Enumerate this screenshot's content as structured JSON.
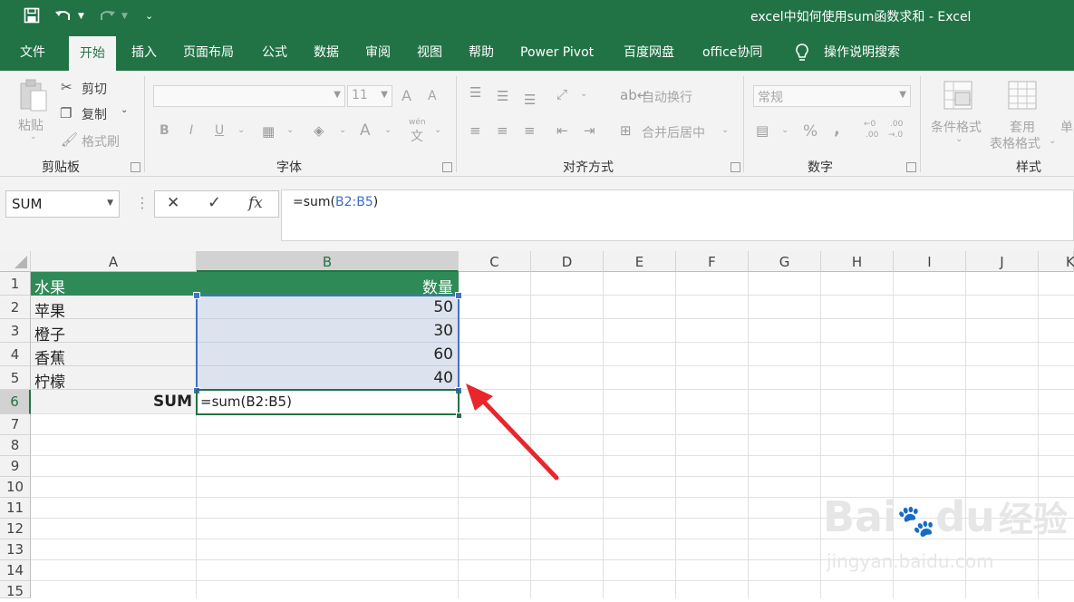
{
  "titlebar": {
    "title": "excel中如何使用sum函数求和  -  Excel",
    "bg_color": "#217346",
    "icons": [
      "save-icon",
      "undo-icon",
      "redo-icon",
      "customize-qat-icon"
    ]
  },
  "tabs": [
    "文件",
    "开始",
    "插入",
    "页面布局",
    "公式",
    "数据",
    "审阅",
    "视图",
    "帮助",
    "Power Pivot",
    "百度网盘",
    "office协同",
    "操作说明搜索"
  ],
  "active_tab": "开始",
  "ribbon": {
    "clipboard": {
      "paste": "粘贴",
      "cut": "剪切",
      "copy": "复制",
      "format_painter": "格式刷",
      "label": "剪贴板"
    },
    "font": {
      "size": "11",
      "bold": "B",
      "italic": "I",
      "underline": "U",
      "font_color": "A",
      "phonetic_top": "wén",
      "phonetic_bottom": "文",
      "grow": "A",
      "shrink": "A",
      "label": "字体"
    },
    "alignment": {
      "wrap_text": "自动换行",
      "merge_center": "合并后居中",
      "label": "对齐方式"
    },
    "number": {
      "format": "常规",
      "percent": "%",
      "comma": ",",
      "inc_decimal_top": "←0",
      "inc_decimal_bottom": ".00",
      "dec_decimal_top": ".00",
      "dec_decimal_bottom": "→.0",
      "label": "数字"
    },
    "styles": {
      "conditional": "条件格式",
      "table_format_1": "套用",
      "table_format_2": "表格格式",
      "cell_styles": "单",
      "label": "样式"
    }
  },
  "formula_bar": {
    "name_box": "SUM",
    "cancel": "✕",
    "enter": "✓",
    "fx": "fx",
    "formula_prefix": "=sum(",
    "formula_ref": "B2:B5",
    "formula_suffix": ")"
  },
  "columns": [
    "A",
    "B",
    "C",
    "D",
    "E",
    "F",
    "G",
    "H",
    "I",
    "J",
    "K"
  ],
  "rows": [
    "1",
    "2",
    "3",
    "4",
    "5",
    "6",
    "7",
    "8",
    "9",
    "10",
    "11",
    "12",
    "13",
    "14",
    "15"
  ],
  "table": {
    "header": {
      "a": "水果",
      "b": "数量"
    },
    "rows": [
      {
        "a": "苹果",
        "b": "50"
      },
      {
        "a": "橙子",
        "b": "30"
      },
      {
        "a": "香蕉",
        "b": "60"
      },
      {
        "a": "柠檬",
        "b": "40"
      }
    ],
    "sum_label": "SUM",
    "sum_formula": "=sum(B2:B5)"
  },
  "colors": {
    "header_green": "#2e8b57",
    "range_fill": "#dce3ee",
    "range_border": "#4472c4",
    "active_border": "#217346",
    "arrow": "#e8262c"
  },
  "watermark": {
    "brand_a": "Bai",
    "brand_b": "du",
    "brand_c": "经验",
    "url": "jingyan.baidu.com"
  }
}
